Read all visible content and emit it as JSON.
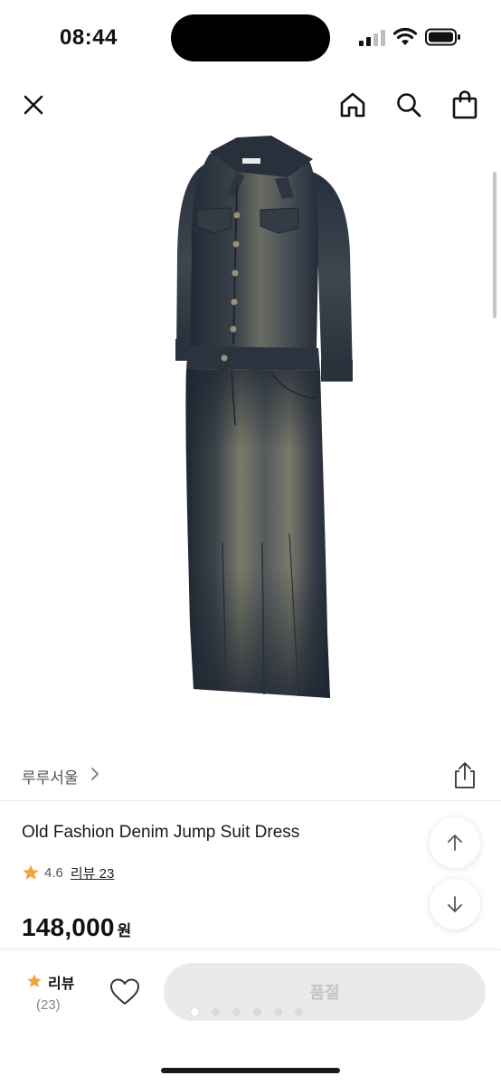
{
  "status_bar": {
    "time": "08:44"
  },
  "header": {
    "icons": [
      "close-icon",
      "home-icon",
      "search-icon",
      "shopping-bag-icon"
    ]
  },
  "product": {
    "image_icon": "denim-dress-image",
    "brand": "루루서울",
    "title": "Old Fashion Denim Jump Suit Dress",
    "rating": "4.6",
    "review_link": "리뷰 23",
    "price": "148,000",
    "currency": "원"
  },
  "floating_buttons": {
    "up_icon": "arrow-up-icon",
    "down_icon": "arrow-down-icon"
  },
  "bottom_bar": {
    "review_label": "리뷰",
    "review_count": "(23)",
    "action_label": "품절"
  },
  "image_carousel": {
    "total": 6,
    "active_index": 0
  },
  "colors": {
    "star": "#f2a53a",
    "soldout_bg": "#eaeaea",
    "soldout_text": "#c4c4c4"
  }
}
